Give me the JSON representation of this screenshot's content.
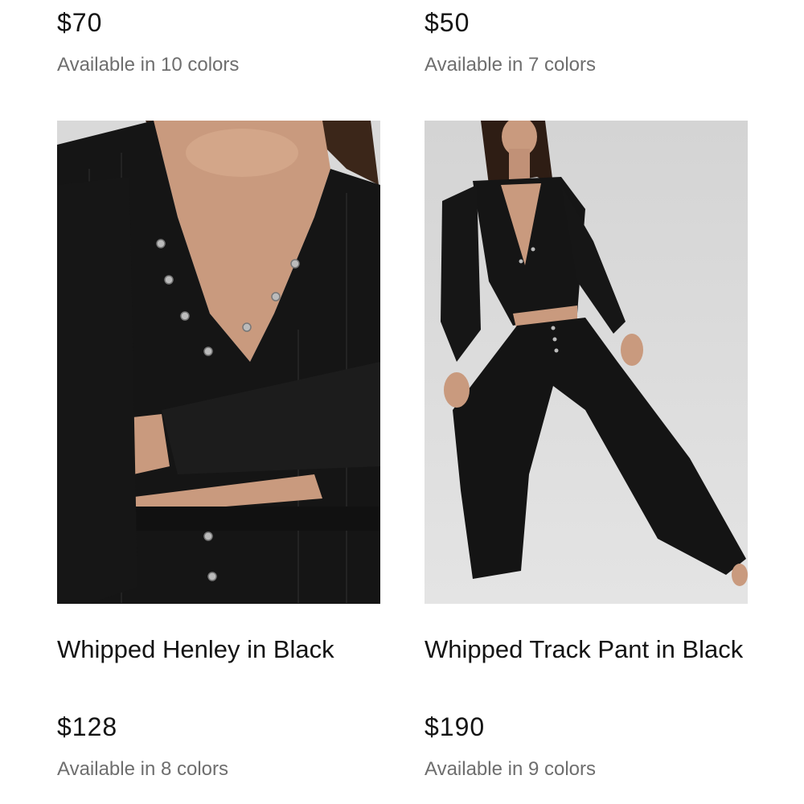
{
  "products_top": [
    {
      "price": "$70",
      "colors_text": "Available in 10 colors"
    },
    {
      "price": "$50",
      "colors_text": "Available in 7 colors"
    }
  ],
  "products": [
    {
      "name": "Whipped Henley in Black",
      "price": "$128",
      "colors_text": "Available in 8 colors"
    },
    {
      "name": "Whipped Track Pant in Black",
      "price": "$190",
      "colors_text": "Available in 9 colors"
    }
  ],
  "colors": {
    "price_text": "#141414",
    "secondary_text": "#6e6e6e",
    "photo_background": "#dcdcdc",
    "garment": "#151515",
    "skin": "#c99a7e"
  }
}
